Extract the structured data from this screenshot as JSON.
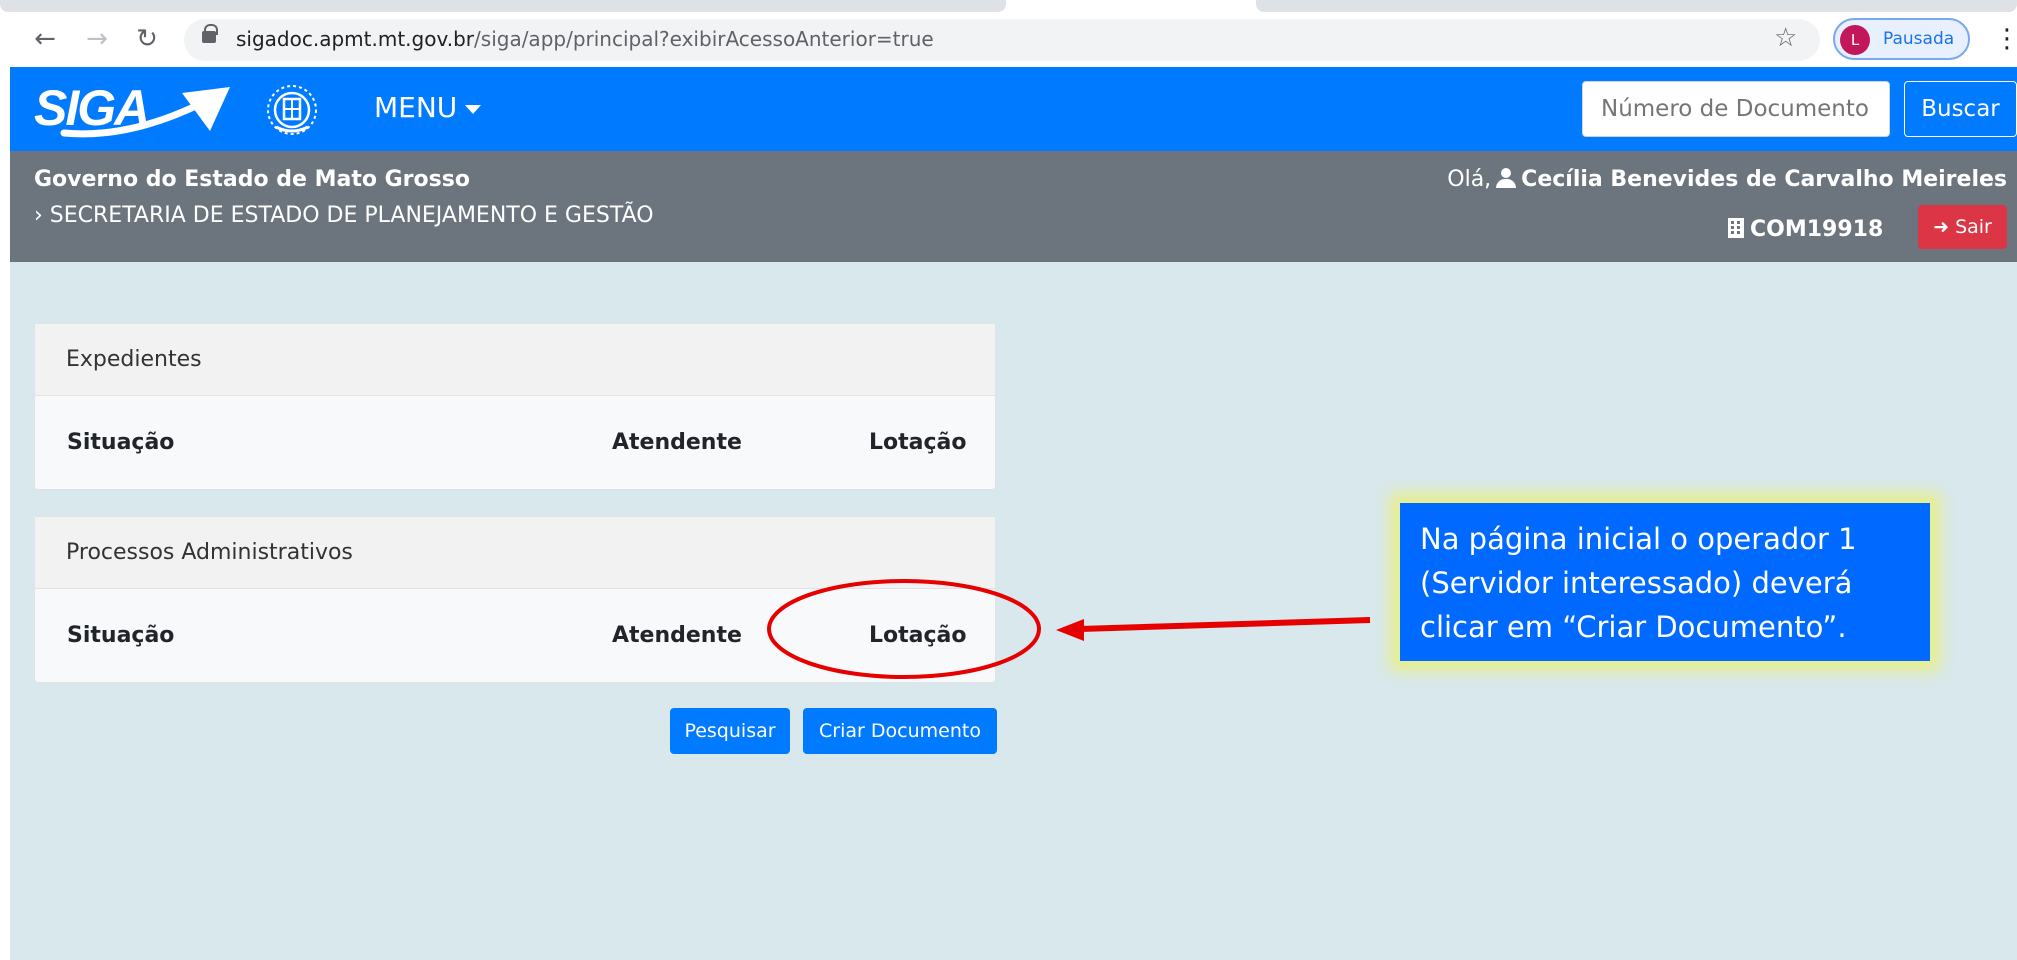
{
  "browser": {
    "url_host": "sigadoc.apmt.mt.gov.br",
    "url_path": "/siga/app/principal?exibirAcessoAnterior=true",
    "profile_initial": "L",
    "profile_label": "Pausada"
  },
  "header": {
    "logo_text": "SIGA",
    "menu_label": "MENU",
    "search_placeholder": "Número de Documento",
    "search_button": "Buscar"
  },
  "info_bar": {
    "org_name": "Governo do Estado de Mato Grosso",
    "department": "› SECRETARIA DE ESTADO DE PLANEJAMENTO E GESTÃO",
    "greeting_prefix": "Olá,",
    "user_name": "Cecília Benevides de Carvalho Meireles",
    "lotacao_code": "COM19918",
    "logout_button": "Sair"
  },
  "panels": [
    {
      "title": "Expedientes",
      "columns": [
        "Situação",
        "Atendente",
        "Lotação"
      ]
    },
    {
      "title": "Processos Administrativos",
      "columns": [
        "Situação",
        "Atendente",
        "Lotação"
      ]
    }
  ],
  "actions": {
    "search_label": "Pesquisar",
    "create_label": "Criar Documento"
  },
  "annotation": {
    "text": "Na página inicial  o operador  1 (Servidor interessado) deverá clicar em “Criar Documento”."
  },
  "colors": {
    "brand_blue": "#007bff",
    "info_grey": "#6c757d",
    "danger_red": "#dc3545",
    "annotation_blue": "#0069ff",
    "markup_red": "#e60000"
  }
}
